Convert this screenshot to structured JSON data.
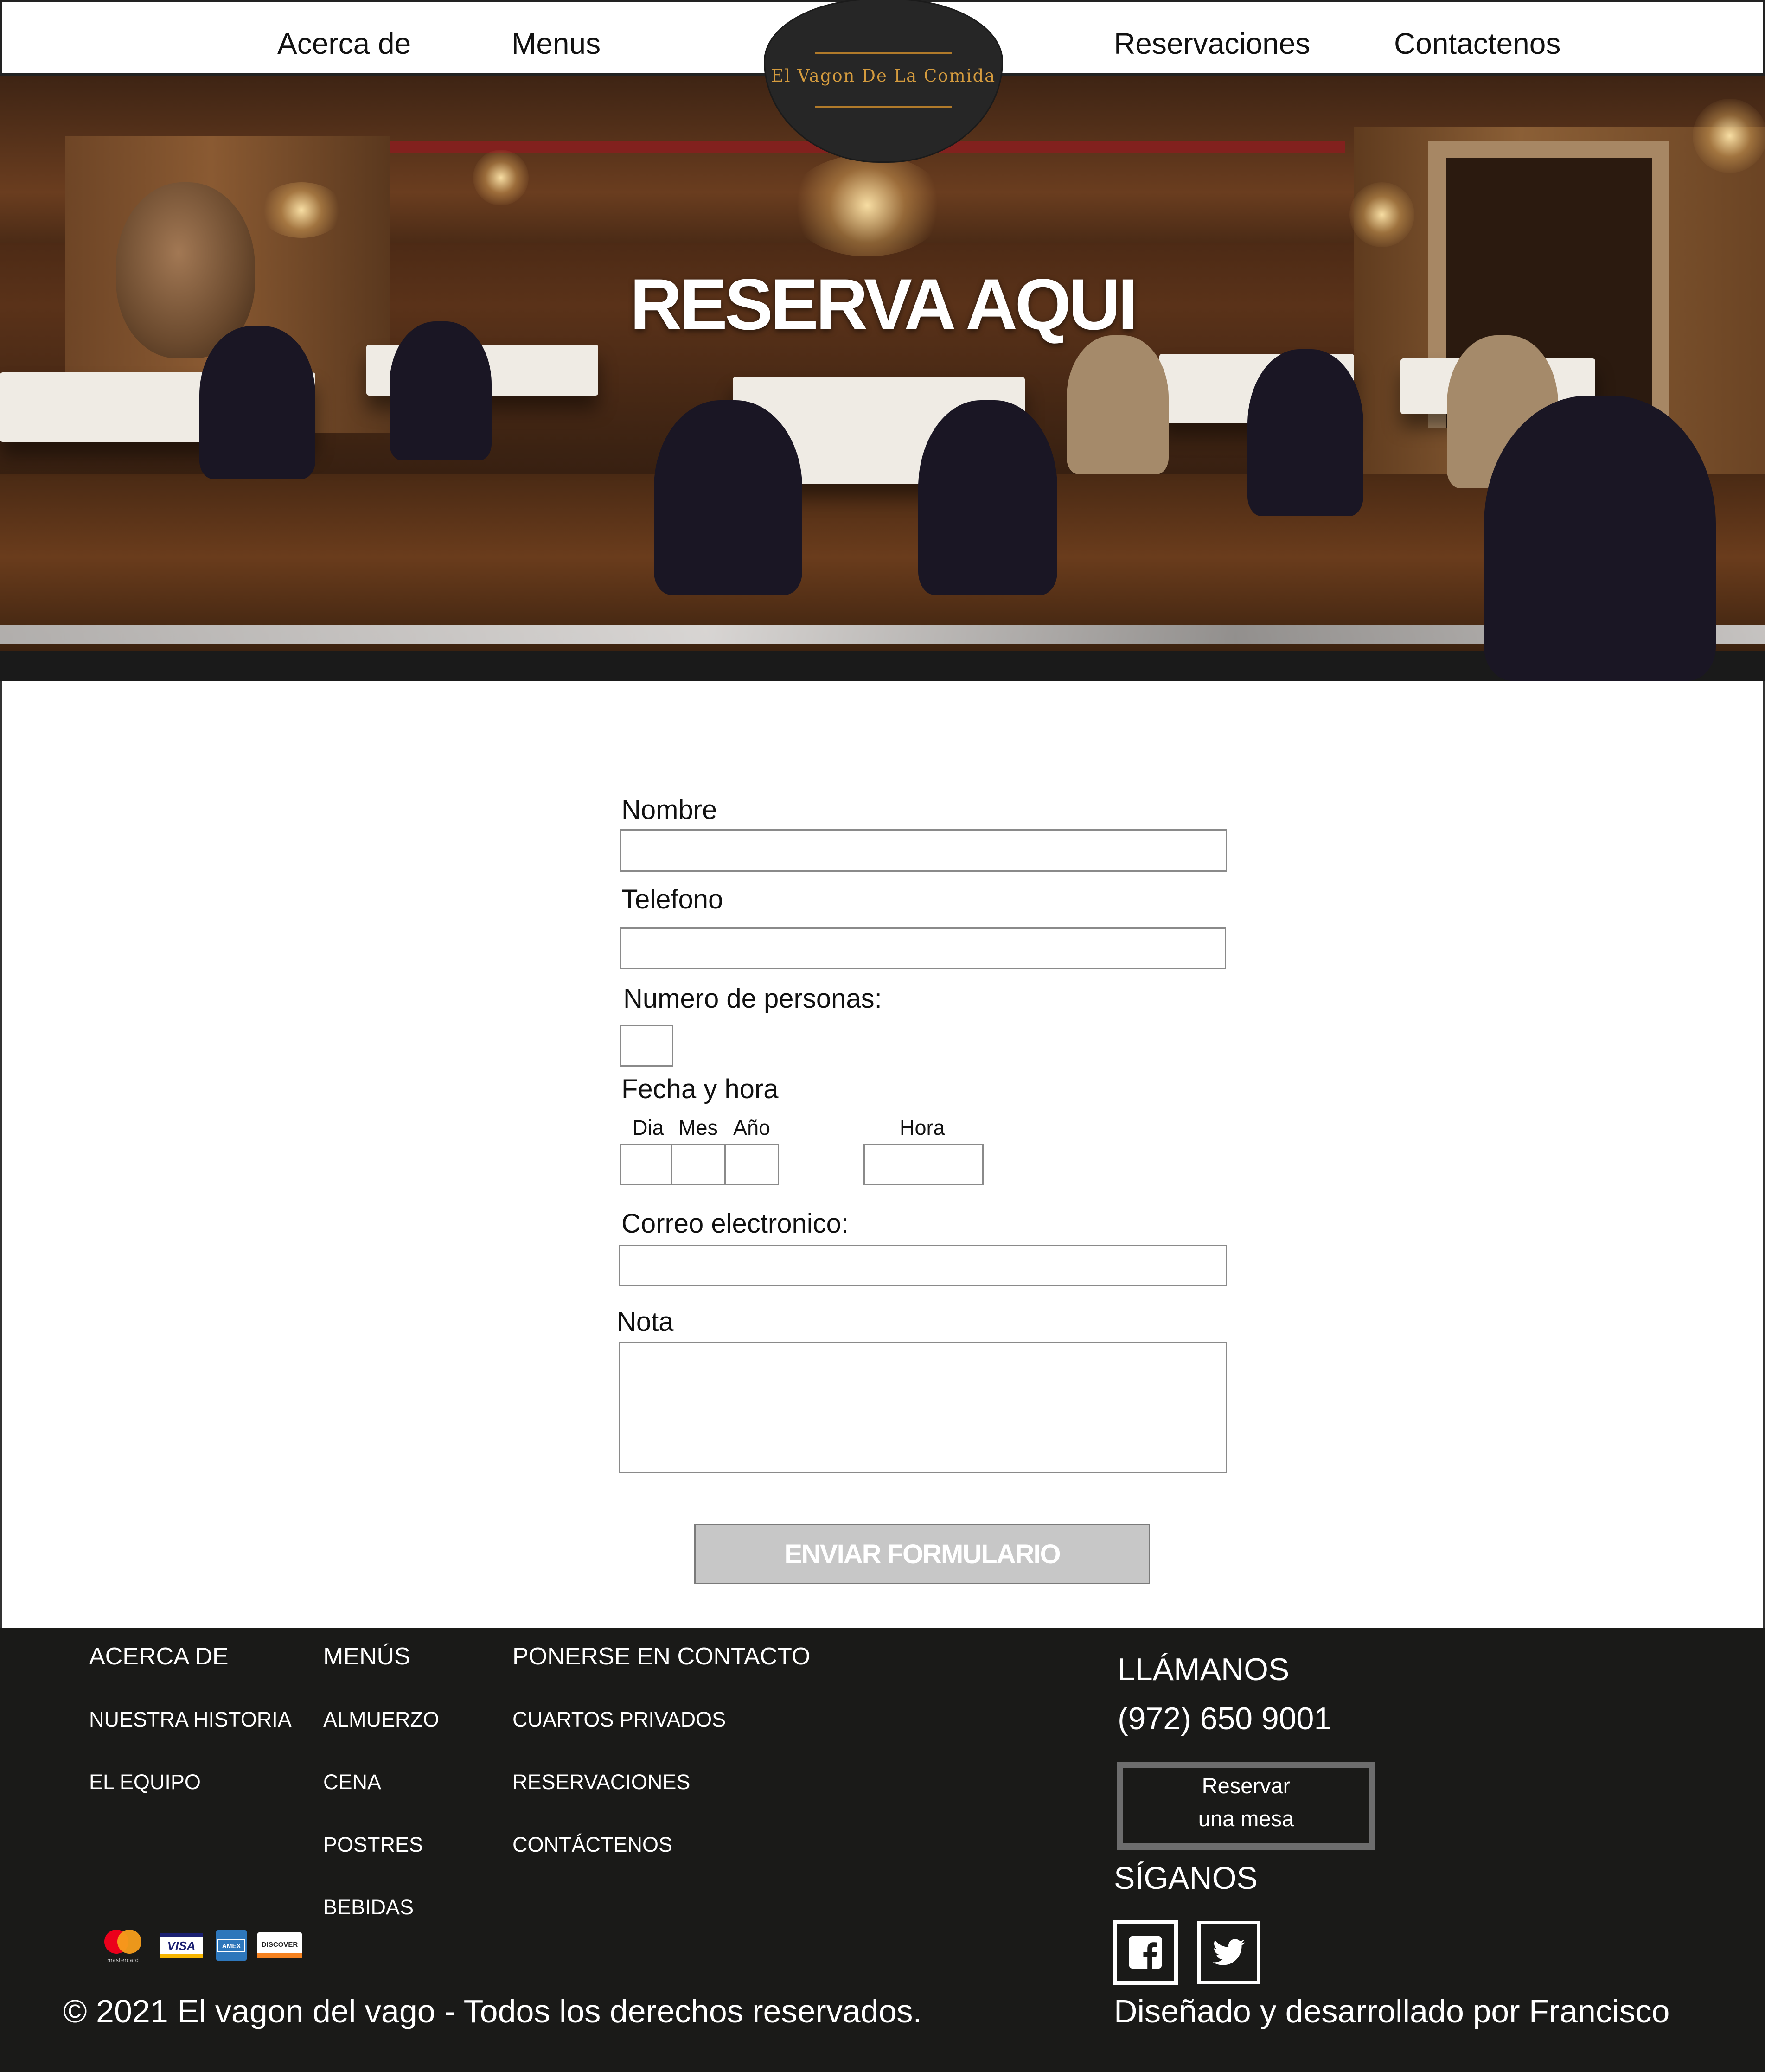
{
  "nav": {
    "items": [
      {
        "label": "Acerca de"
      },
      {
        "label": "Menus"
      },
      {
        "label": "Reservaciones"
      },
      {
        "label": "Contactenos"
      }
    ],
    "logo_text": "El Vagon De La Comida"
  },
  "hero": {
    "title": "RESERVA AQUI"
  },
  "form": {
    "name_label": "Nombre",
    "name_value": "",
    "phone_label": "Telefono",
    "phone_value": "",
    "people_label": "Numero de personas:",
    "people_value": "",
    "datetime_label": "Fecha y hora",
    "day_label": "Dia",
    "month_label": "Mes",
    "year_label": "Año",
    "hour_label": "Hora",
    "email_label": "Correo electronico:",
    "email_value": "",
    "note_label": "Nota",
    "note_value": "",
    "submit_label": "ENVIAR FORMULARIO"
  },
  "footer": {
    "col1": {
      "heading": "ACERCA DE",
      "items": [
        "NUESTRA HISTORIA",
        "EL EQUIPO"
      ]
    },
    "col2": {
      "heading": "MENÚS",
      "items": [
        "ALMUERZO",
        "CENA",
        "POSTRES",
        "BEBIDAS"
      ]
    },
    "col3": {
      "heading": "PONERSE EN CONTACTO",
      "items": [
        "CUARTOS PRIVADOS",
        "RESERVACIONES",
        "CONTÁCTENOS"
      ]
    },
    "call_heading": "LLÁMANOS",
    "phone": "(972) 650 9001",
    "reserve_line1": "Reservar",
    "reserve_line2": "una mesa",
    "follow_heading": "SÍGANOS",
    "social": [
      "facebook-icon",
      "twitter-icon"
    ],
    "payment_icons": [
      "mastercard-icon",
      "visa-icon",
      "amex-icon",
      "discover-icon"
    ],
    "payment_labels": {
      "visa": "VISA",
      "discover": "DISCOVER",
      "mastercard": "mastercard",
      "amex": "AMEX"
    },
    "copyright": "© 2021 El vagon del vago - Todos los derechos reservados.",
    "credit": "Diseñado y desarrollado por Francisco"
  },
  "colors": {
    "footer_bg": "#1a1a18",
    "logo_bg": "#262626",
    "logo_accent": "#d49b3e",
    "submit_bg": "#c7c7c7"
  }
}
